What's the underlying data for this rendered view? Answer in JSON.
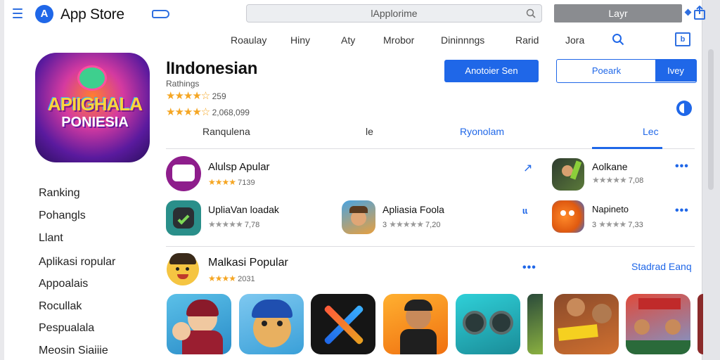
{
  "header": {
    "app_logo_glyph": "A",
    "app_title": "App Store",
    "search_value": "lApplorime",
    "right_button": "Layr"
  },
  "nav": {
    "items": [
      "Roaulay",
      "Hiny",
      "Aty",
      "Mrobor",
      "Dininnngs",
      "Rarid",
      "Jora"
    ],
    "box_icon_glyph": "b"
  },
  "sidebar": {
    "hero_text_line1": "APIIGHALA",
    "hero_text_line2": "PONIESIA",
    "items": [
      "Ranking",
      "Pohangls",
      "Llant",
      "Aplikasi ropular",
      "Appoalais",
      "Rocullak",
      "Pespualala",
      "Meosin Siaiiie"
    ]
  },
  "hero": {
    "title": "lIndonesian",
    "subtitle": "Rathings",
    "rating1_stars": "★★★★☆",
    "rating1_value": "259",
    "rating2_stars": "★★★★☆",
    "rating2_value": "2,068,099",
    "primary_button": "Anotoier Sen",
    "secondary_button": "Poeark",
    "secondary_button_right": "Ivey"
  },
  "subtabs": [
    "Ranqulena",
    "le",
    "Ryonolam",
    "Lec"
  ],
  "apps": [
    {
      "name": "Alulsp Apular",
      "stars": "★★★★",
      "rating": "7139",
      "action_glyph": "↗"
    },
    {
      "name": "Aolkane",
      "stars": "★★★★★",
      "rating": "7,08"
    },
    {
      "name": "UpliaVan loadak",
      "stars": "★★★★★",
      "rating": "7,78"
    },
    {
      "name": "Apliasia Foola",
      "prefix": "3",
      "stars": "★★★★★",
      "rating": "7,20",
      "action_glyph": "ꟷ"
    },
    {
      "name": "Napineto",
      "prefix": "3",
      "stars": "★★★★",
      "rating": "7,33"
    }
  ],
  "popular_section": {
    "title": "Malkasi Popular",
    "stars": "★★★★",
    "rating": "2031",
    "link": "Stadrad Eanq"
  },
  "colors": {
    "accent": "#1f67e8",
    "star": "#f5a623",
    "hero_gradient_mid": "#d43aa0"
  }
}
